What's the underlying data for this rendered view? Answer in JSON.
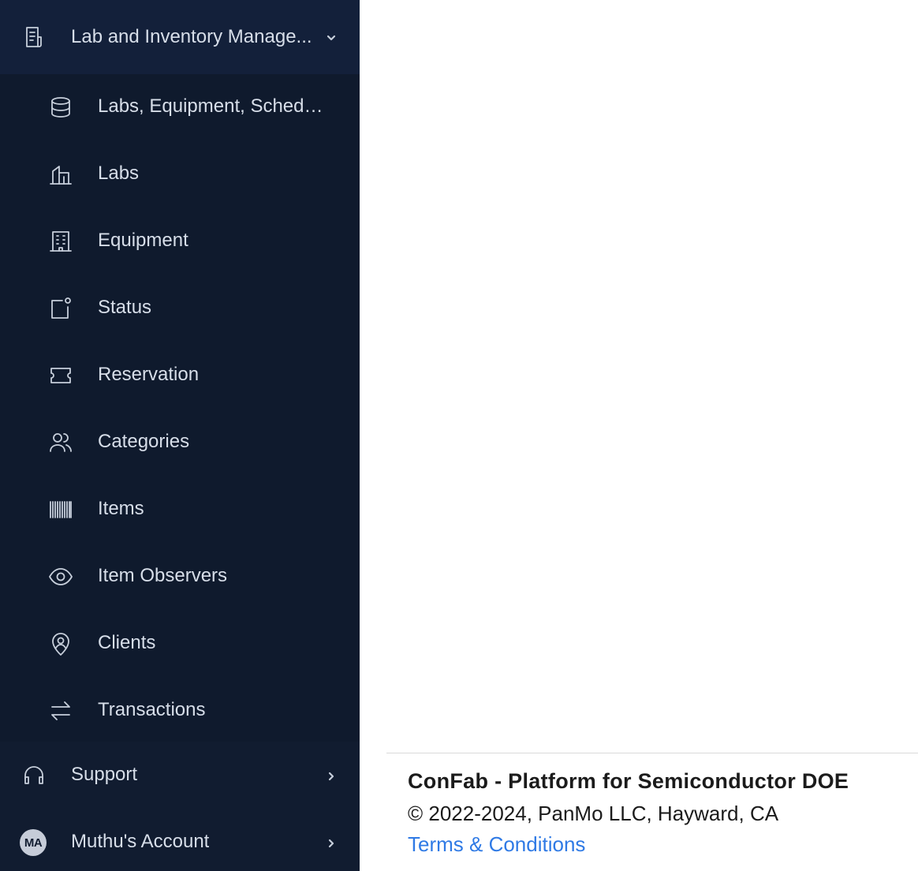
{
  "sidebar": {
    "section": {
      "label": "Lab and Inventory Manage...",
      "icon": "document-list-icon",
      "expanded": true
    },
    "items": [
      {
        "label": "Labs, Equipment, Schedul...",
        "icon": "database-icon"
      },
      {
        "label": "Labs",
        "icon": "building-icon"
      },
      {
        "label": "Equipment",
        "icon": "office-building-icon"
      },
      {
        "label": "Status",
        "icon": "notification-square-icon"
      },
      {
        "label": "Reservation",
        "icon": "ticket-icon"
      },
      {
        "label": "Categories",
        "icon": "users-icon"
      },
      {
        "label": "Items",
        "icon": "barcode-icon"
      },
      {
        "label": "Item Observers",
        "icon": "eye-icon"
      },
      {
        "label": "Clients",
        "icon": "map-pin-user-icon"
      },
      {
        "label": "Transactions",
        "icon": "arrows-left-right-icon"
      }
    ],
    "support": {
      "label": "Support",
      "icon": "headset-icon"
    },
    "account": {
      "label": "Muthu's Account",
      "initials": "MA"
    }
  },
  "footer": {
    "title": "ConFab - Platform for Semiconductor DOE",
    "copyright": "© 2022-2024, PanMo LLC, Hayward, CA",
    "link": "Terms & Conditions"
  },
  "colors": {
    "sidebar_bg": "#111c30",
    "link": "#2f7ae5"
  }
}
